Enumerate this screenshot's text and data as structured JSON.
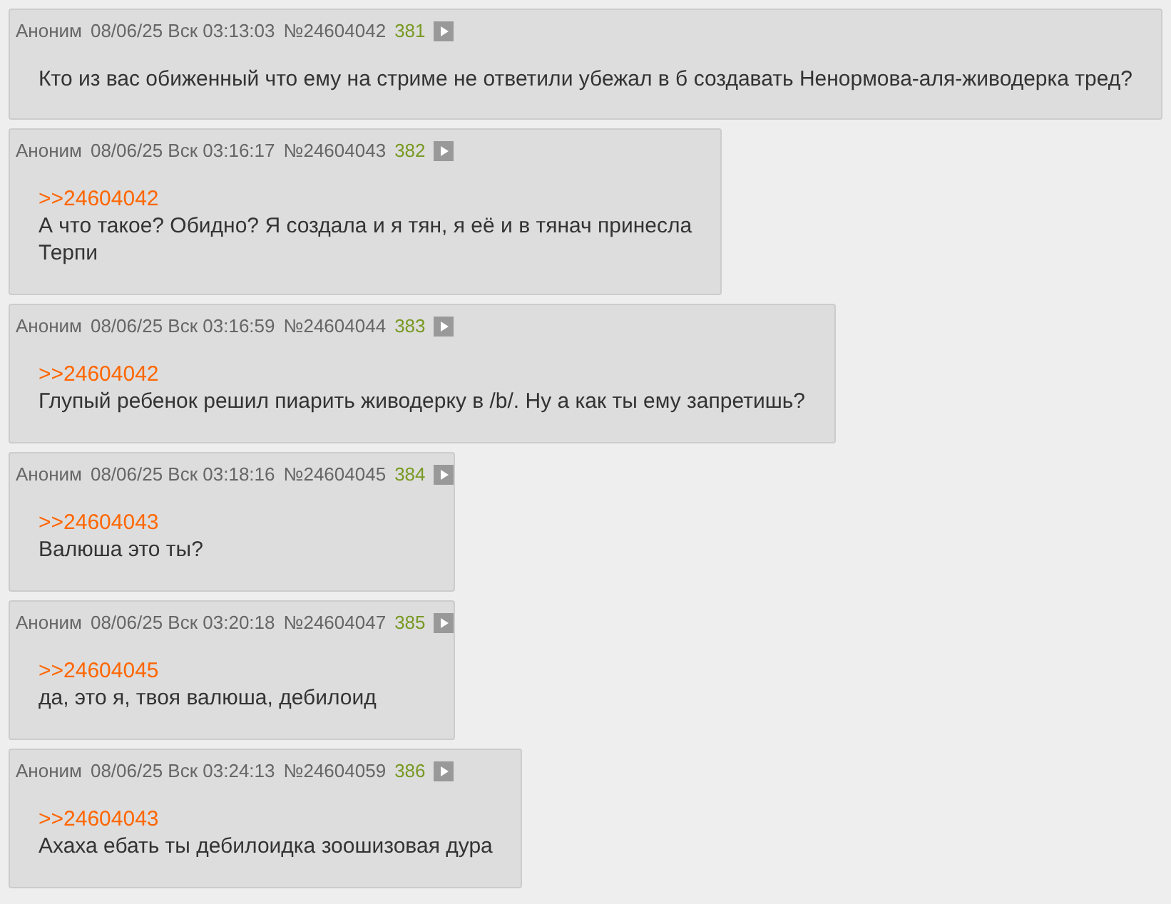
{
  "posts": [
    {
      "author": "Аноним",
      "date": "08/06/25 Вск 03:13:03",
      "number": "№24604042",
      "ordinal": "381",
      "lines": [
        "Кто из вас обиженный что ему на стриме не ответили убежал в б создавать Ненормова-аля-живодерка тред?"
      ]
    },
    {
      "author": "Аноним",
      "date": "08/06/25 Вск 03:16:17",
      "number": "№24604043",
      "ordinal": "382",
      "reply_links": [
        ">>24604042"
      ],
      "lines": [
        "А что такое? Обидно? Я создала и я тян, я её и в тянач принесла",
        "Терпи"
      ]
    },
    {
      "author": "Аноним",
      "date": "08/06/25 Вск 03:16:59",
      "number": "№24604044",
      "ordinal": "383",
      "reply_links": [
        ">>24604042"
      ],
      "lines": [
        "Глупый ребенок решил пиарить живодерку в /b/. Ну а как ты ему запретишь?"
      ]
    },
    {
      "author": "Аноним",
      "date": "08/06/25 Вск 03:18:16",
      "number": "№24604045",
      "ordinal": "384",
      "reply_links": [
        ">>24604043"
      ],
      "lines": [
        "Валюша это ты?"
      ]
    },
    {
      "author": "Аноним",
      "date": "08/06/25 Вск 03:20:18",
      "number": "№24604047",
      "ordinal": "385",
      "reply_links": [
        ">>24604045"
      ],
      "lines": [
        "да, это я, твоя валюша, дебилоид"
      ]
    },
    {
      "author": "Аноним",
      "date": "08/06/25 Вск 03:24:13",
      "number": "№24604059",
      "ordinal": "386",
      "reply_links": [
        ">>24604043"
      ],
      "lines": [
        "Ахаха ебать ты дебилоидка зоошизовая дура"
      ]
    }
  ]
}
